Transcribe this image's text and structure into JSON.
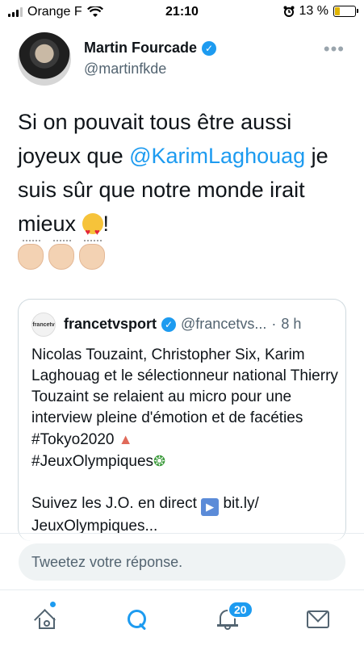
{
  "status_bar": {
    "carrier": "Orange F",
    "time": "21:10",
    "battery": "13 %",
    "battery_level": 0.13
  },
  "tweet": {
    "author_name": "Martin Fourcade",
    "author_handle": "@martinfkde",
    "verified": true,
    "more_icon": "more-horizontal-icon",
    "text_before_mention": "Si on pouvait tous être aussi joyeux que ",
    "mention": "@KarimLaghouag",
    "text_after_mention": " je suis sûr que notre monde irait mieux ",
    "text_end": "!",
    "emojis": [
      "heart-eyes-emoji",
      "clapping-hands-emoji",
      "clapping-hands-emoji",
      "clapping-hands-emoji"
    ]
  },
  "quoted_tweet": {
    "avatar_text": "francetv sport",
    "name": "francetvsport",
    "handle": "@francetvs...",
    "separator": "·",
    "time": "8 h",
    "line1": "Nicolas Touzaint, Christopher Six, Karim Laghouag et le sélectionneur national Thierry Touzaint se relaient au micro pour une interview pleine d'émotion et de facéties #Tokyo2020",
    "hashtag2": "#JeuxOlympiques",
    "line3_prefix": "Suivez les J.O. en direct",
    "link": "bit.ly/ JeuxOlympiques..."
  },
  "reply": {
    "placeholder": "Tweetez votre réponse."
  },
  "tabbar": {
    "items": [
      {
        "name": "home",
        "icon": "home-icon"
      },
      {
        "name": "search",
        "icon": "search-icon"
      },
      {
        "name": "notifications",
        "icon": "bell-icon"
      },
      {
        "name": "messages",
        "icon": "mail-icon"
      }
    ],
    "notifications_badge": "20"
  },
  "colors": {
    "accent": "#1d9bf0",
    "text": "#0f1419",
    "secondary_text": "#536471",
    "reply_bg": "#eff3f4"
  }
}
